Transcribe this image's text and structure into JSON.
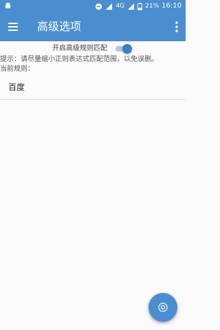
{
  "status_bar": {
    "network": "4G",
    "battery": "21%",
    "time": "16:10"
  },
  "app_bar": {
    "title": "高级选项",
    "menu_icon": "menu-icon",
    "more_icon": "more-vert-icon"
  },
  "advanced_toggle": {
    "label": "开启高级规则匹配",
    "enabled": true
  },
  "hint": "提示：请尽量缩小正则表达式匹配范围，以免误删。",
  "current_rules_label": "当前规则：",
  "rules": [
    "百度"
  ],
  "fab": {
    "icon": "target-icon"
  },
  "colors": {
    "primary": "#4a8ed0",
    "accent": "#3a80c8",
    "background": "#fafafa"
  }
}
